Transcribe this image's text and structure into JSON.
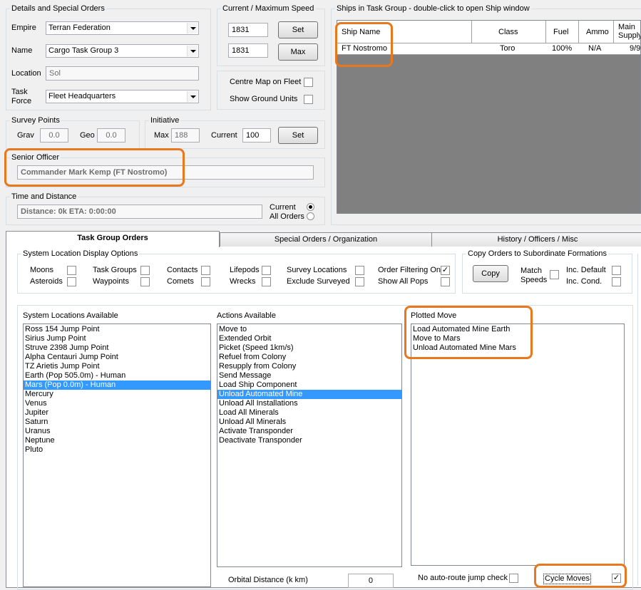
{
  "details": {
    "title": "Details and Special Orders",
    "empire_label": "Empire",
    "empire_value": "Terran Federation",
    "name_label": "Name",
    "name_value": "Cargo Task Group 3",
    "location_label": "Location",
    "location_value": "Sol",
    "taskforce_label_1": "Task",
    "taskforce_label_2": "Force",
    "taskforce_value": "Fleet Headquarters"
  },
  "speed": {
    "title": "Current / Maximum Speed",
    "current": "1831",
    "maximum": "1831",
    "set_label": "Set",
    "max_label": "Max"
  },
  "map_options": {
    "centre_label": "Centre Map on Fleet",
    "ground_label": "Show Ground Units"
  },
  "survey": {
    "title": "Survey Points",
    "grav_label": "Grav",
    "grav_value": "0.0",
    "geo_label": "Geo",
    "geo_value": "0.0"
  },
  "initiative": {
    "title": "Initiative",
    "max_label": "Max",
    "max_value": "188",
    "current_label": "Current",
    "current_value": "100",
    "set_label": "Set"
  },
  "senior_officer": {
    "title": "Senior Officer",
    "value": "Commander Mark Kemp (FT Nostromo)"
  },
  "time_distance": {
    "title": "Time and Distance",
    "value": "Distance: 0k  ETA: 0:00:00",
    "current_label": "Current",
    "all_orders_label": "All Orders"
  },
  "ships": {
    "title": "Ships in Task Group - double-click to open Ship window",
    "columns": [
      "Ship Name",
      "Class",
      "Fuel",
      "Ammo",
      "Main Supply"
    ],
    "column_display": [
      "Ship Name",
      "Class",
      "Fuel",
      "Ammo",
      "Main Supply"
    ],
    "rows": [
      {
        "name": "FT Nostromo",
        "class": "Toro",
        "fuel": "100%",
        "ammo": "N/A",
        "supply": "9/9"
      }
    ]
  },
  "tabs": [
    {
      "label": "Task Group Orders"
    },
    {
      "label": "Special Orders / Organization"
    },
    {
      "label": "History / Officers / Misc"
    }
  ],
  "display_options": {
    "title": "System Location Display Options",
    "moons": "Moons",
    "asteroids": "Asteroids",
    "task_groups": "Task Groups",
    "waypoints": "Waypoints",
    "contacts": "Contacts",
    "comets": "Comets",
    "lifepods": "Lifepods",
    "wrecks": "Wrecks",
    "survey_locations": "Survey Locations",
    "exclude_surveyed": "Exclude Surveyed",
    "order_filtering": "Order Filtering On",
    "show_all_pops": "Show All Pops"
  },
  "copy_orders": {
    "title": "Copy Orders to Subordinate Formations",
    "copy_label": "Copy",
    "match_label_1": "Match",
    "match_label_2": "Speeds",
    "inc_default": "Inc. Default",
    "inc_cond": "Inc. Cond."
  },
  "locations": {
    "title": "System Locations Available",
    "items": [
      "Ross 154 Jump Point",
      "Sirius Jump Point",
      "Struve 2398 Jump Point",
      "Alpha Centauri Jump Point",
      "TZ Arietis Jump Point",
      "Earth  (Pop 505.0m) - Human",
      "Mars  (Pop 0.0m) - Human",
      "Mercury",
      "Venus",
      "Jupiter",
      "Saturn",
      "Uranus",
      "Neptune",
      "Pluto"
    ],
    "selected": "Mars  (Pop 0.0m) - Human"
  },
  "actions": {
    "title": "Actions Available",
    "items": [
      "Move to",
      "Extended Orbit",
      "Picket (Speed 1km/s)",
      "Refuel from Colony",
      "Resupply from Colony",
      "Send Message",
      "Load Ship Component",
      "Unload Automated Mine",
      "Unload All Installations",
      "Load All Minerals",
      "Unload All Minerals",
      "Activate Transponder",
      "Deactivate Transponder"
    ],
    "selected": "Unload Automated Mine"
  },
  "plotted": {
    "title": "Plotted Move",
    "items": [
      "Load Automated Mine Earth",
      "Move to Mars",
      "Unload Automated Mine Mars"
    ]
  },
  "bottom": {
    "orbital_label": "Orbital Distance (k km)",
    "orbital_value": "0",
    "no_autoroute_label": "No auto-route jump check",
    "cycle_label": "Cycle Moves"
  },
  "colors": {
    "highlight": "#e8781e",
    "selection": "#3399ff",
    "grid_bg": "#808080"
  }
}
